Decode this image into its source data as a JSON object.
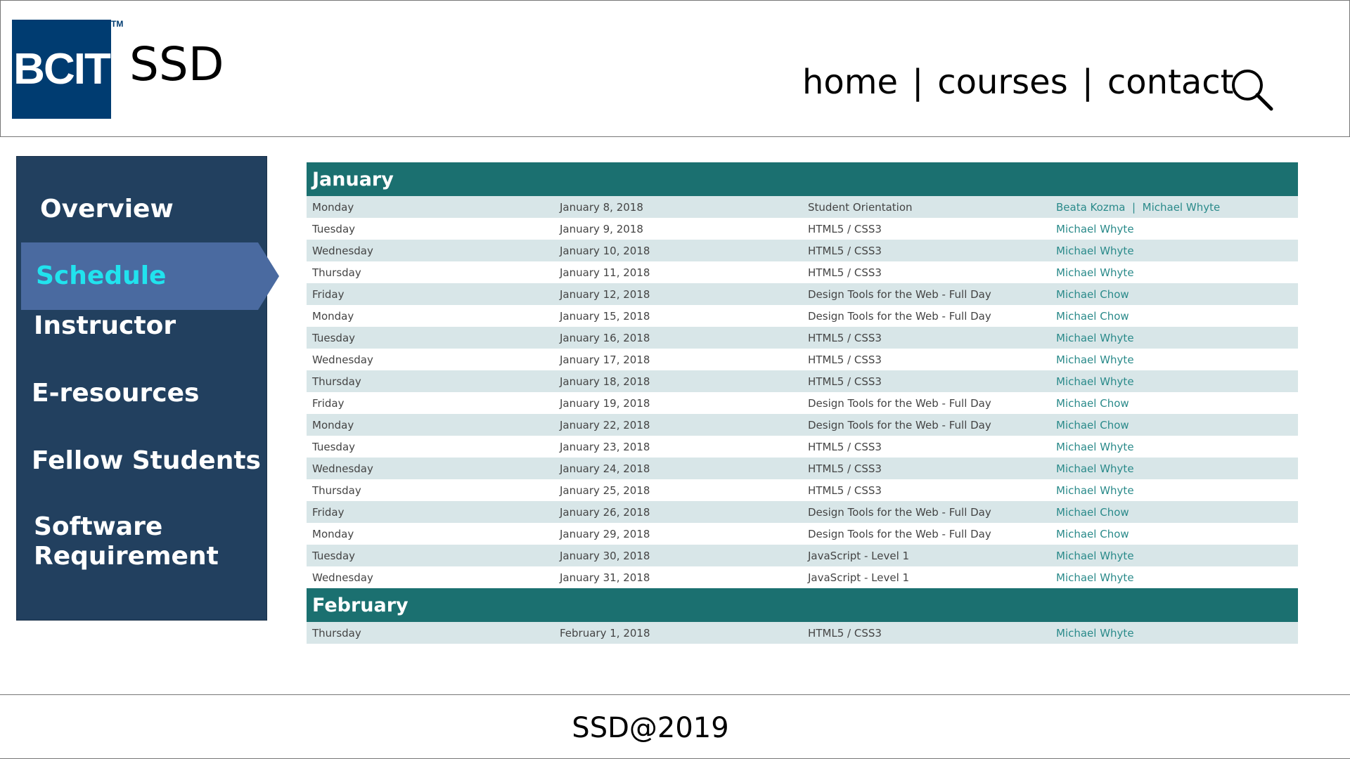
{
  "logo": {
    "text": "BCIT",
    "trademark": "TM",
    "brand_color": "#003c71"
  },
  "site_title": "SSD",
  "top_nav": {
    "links": [
      "home",
      "courses",
      "contact"
    ],
    "separator": "|",
    "search_icon": "search-icon"
  },
  "sidebar": {
    "background": "#22405f",
    "active_color": "#21e3ee",
    "items": [
      {
        "label": "Overview"
      },
      {
        "label": "Schedule",
        "active": true
      },
      {
        "label": "Instructor"
      },
      {
        "label": "E-resources"
      },
      {
        "label": "Fellow Students"
      },
      {
        "label": "Software Requirement"
      }
    ]
  },
  "schedule": {
    "header_color": "#1b7070",
    "months": [
      {
        "name": "January",
        "rows": [
          {
            "day": "Monday",
            "date": "January 8, 2018",
            "course": "Student Orientation",
            "instructors": [
              "Beata Kozma",
              "Michael Whyte"
            ]
          },
          {
            "day": "Tuesday",
            "date": "January 9, 2018",
            "course": "HTML5 / CSS3",
            "instructors": [
              "Michael Whyte"
            ]
          },
          {
            "day": "Wednesday",
            "date": "January 10, 2018",
            "course": "HTML5 / CSS3",
            "instructors": [
              "Michael Whyte"
            ]
          },
          {
            "day": "Thursday",
            "date": "January 11, 2018",
            "course": "HTML5 / CSS3",
            "instructors": [
              "Michael Whyte"
            ]
          },
          {
            "day": "Friday",
            "date": "January 12, 2018",
            "course": "Design Tools for the Web - Full Day",
            "instructors": [
              "Michael Chow"
            ]
          },
          {
            "day": "Monday",
            "date": "January 15, 2018",
            "course": "Design Tools for the Web - Full Day",
            "instructors": [
              "Michael Chow"
            ]
          },
          {
            "day": "Tuesday",
            "date": "January 16, 2018",
            "course": "HTML5 / CSS3",
            "instructors": [
              "Michael Whyte"
            ]
          },
          {
            "day": "Wednesday",
            "date": "January 17, 2018",
            "course": "HTML5 / CSS3",
            "instructors": [
              "Michael Whyte"
            ]
          },
          {
            "day": "Thursday",
            "date": "January 18, 2018",
            "course": "HTML5 / CSS3",
            "instructors": [
              "Michael Whyte"
            ]
          },
          {
            "day": "Friday",
            "date": "January 19, 2018",
            "course": "Design Tools for the Web - Full Day",
            "instructors": [
              "Michael Chow"
            ]
          },
          {
            "day": "Monday",
            "date": "January 22, 2018",
            "course": "Design Tools for the Web - Full Day",
            "instructors": [
              "Michael Chow"
            ]
          },
          {
            "day": "Tuesday",
            "date": "January 23, 2018",
            "course": "HTML5 / CSS3",
            "instructors": [
              "Michael Whyte"
            ]
          },
          {
            "day": "Wednesday",
            "date": "January 24, 2018",
            "course": "HTML5 / CSS3",
            "instructors": [
              "Michael Whyte"
            ]
          },
          {
            "day": "Thursday",
            "date": "January 25, 2018",
            "course": "HTML5 / CSS3",
            "instructors": [
              "Michael Whyte"
            ]
          },
          {
            "day": "Friday",
            "date": "January 26, 2018",
            "course": "Design Tools for the Web - Full Day",
            "instructors": [
              "Michael Chow"
            ]
          },
          {
            "day": "Monday",
            "date": "January 29, 2018",
            "course": "Design Tools for the Web - Full Day",
            "instructors": [
              "Michael Chow"
            ]
          },
          {
            "day": "Tuesday",
            "date": "January 30, 2018",
            "course": "JavaScript - Level 1",
            "instructors": [
              "Michael Whyte"
            ]
          },
          {
            "day": "Wednesday",
            "date": "January 31, 2018",
            "course": "JavaScript - Level 1",
            "instructors": [
              "Michael Whyte"
            ]
          }
        ]
      },
      {
        "name": "February",
        "rows": [
          {
            "day": "Thursday",
            "date": "February 1, 2018",
            "course": "HTML5 / CSS3",
            "instructors": [
              "Michael Whyte"
            ]
          }
        ]
      }
    ]
  },
  "footer": {
    "text": "SSD@2019"
  }
}
